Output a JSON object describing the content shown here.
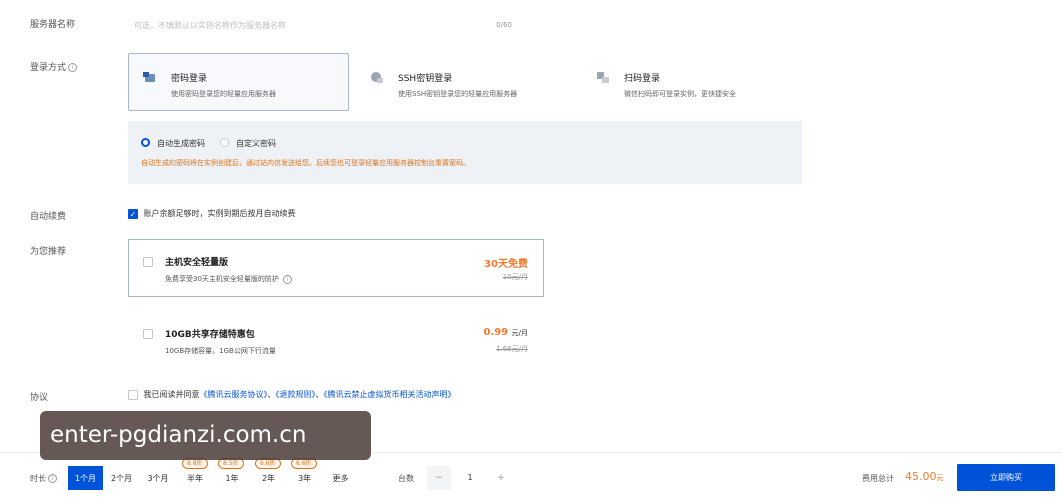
{
  "form": {
    "server_name_label": "服务器名称",
    "server_name_placeholder": "可选，不填默认以实例名称作为服务器名称",
    "server_name_count": "0/60",
    "login_label": "登录方式",
    "login_methods": [
      {
        "title": "密码登录",
        "desc": "使用密码登录您的轻量应用服务器",
        "selected": true
      },
      {
        "title": "SSH密钥登录",
        "desc": "使用SSH密钥登录您的轻量应用服务器",
        "selected": false
      },
      {
        "title": "扫码登录",
        "desc": "微信扫码即可登录实例，更快捷安全",
        "selected": false
      }
    ],
    "password_options": {
      "auto": "自动生成密码",
      "custom": "自定义密码",
      "tip": "自动生成的密码将在实例创建后，通过站内信发送给您。后续您也可登录轻量应用服务器控制台重置密码。"
    },
    "auto_renew_label": "自动续费",
    "auto_renew_text": "账户余额足够时，实例到期后按月自动续费",
    "recommend_label": "为您推荐",
    "recommendations": [
      {
        "title": "主机安全轻量版",
        "desc": "免费享受30天主机安全轻量版的防护",
        "price": "30天免费",
        "unit": "",
        "old_price": "10元/月"
      },
      {
        "title": "10GB共享存储特惠包",
        "desc": "10GB存储容量，1GB公网下行流量",
        "price": "0.99",
        "unit": "元/月",
        "old_price": "1.68元/月"
      }
    ],
    "agreement_label": "协议",
    "agreement_prefix": "我已阅读并同意",
    "agreement_link1": "《腾讯云服务协议》",
    "agreement_sep1": "、",
    "agreement_link2": "《退款规则》",
    "agreement_sep2": "、",
    "agreement_link3": "《腾讯云禁止虚拟货币相关活动声明》"
  },
  "bottom": {
    "duration_label": "时长",
    "durations": [
      "1个月",
      "2个月",
      "3个月",
      "半年",
      "1年",
      "2年",
      "3年",
      "更多"
    ],
    "selected_duration": "1个月",
    "badges": [
      "8.8折",
      "8.5折",
      "6.6折",
      "6.6折"
    ],
    "quantity_label": "台数",
    "quantity": "1",
    "minus": "−",
    "plus": "+",
    "total_label": "费用总计",
    "total_amount": "45.00",
    "total_unit": "元",
    "buy_button": "立即购买"
  },
  "watermark": "enter-pgdianzi.com.cn",
  "colors": {
    "accent": "#0052d9",
    "warning": "#ed7b2f"
  }
}
